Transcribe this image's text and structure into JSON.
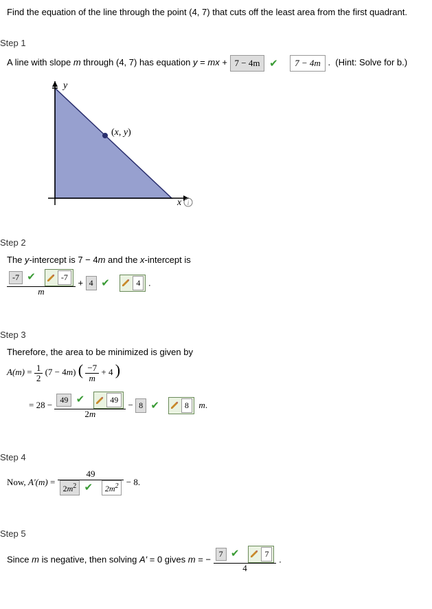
{
  "question": "Find the equation of the line through the point (4, 7) that cuts off the least area from the first quadrant.",
  "step1": {
    "label": "Step 1",
    "pre": "A line with slope ",
    "m": "m",
    "mid": " through (4, 7) has equation ",
    "eq_lhs": "y",
    "eq_mid": " = ",
    "eq_rhs_a": "mx",
    "eq_plus": " + ",
    "answer": "7 − 4m",
    "graded": "7 − 4m",
    "hint": "(Hint: Solve for b.)",
    "dot": "."
  },
  "diagram": {
    "y": "y",
    "x": "x",
    "label": "(x, y)"
  },
  "step2": {
    "label": "Step 2",
    "text_a": "The ",
    "yint": "y",
    "text_b": "-intercept is 7 − 4",
    "m": "m",
    "text_c": " and the ",
    "xint": "x",
    "text_d": "-intercept is",
    "ans1": "-7",
    "ans1_rev": "-7",
    "plus": " + ",
    "ans2": "4",
    "ans2_rev": "4",
    "m_den": "m",
    "period": "."
  },
  "step3": {
    "label": "Step 3",
    "text": "Therefore, the area to be minimized is given by",
    "Am": "A(m)",
    "eq": " = ",
    "half_num": "1",
    "half_den": "2",
    "factor1": "(7 − 4m)",
    "inner_num": "−7",
    "inner_den": "m",
    "inner_plus": " + 4",
    "line2_eq": " = 28 − ",
    "ans_a": "49",
    "ans_a_rev": "49",
    "den_2m": "2m",
    "minus": " − ",
    "ans_b": "8",
    "ans_b_rev": "8",
    "m_suffix": "m."
  },
  "step4": {
    "label": "Step 4",
    "now": "Now, ",
    "Apm": "A'(m)",
    "eq": " = ",
    "num": "49",
    "den_2m2": "2m",
    "sq": "2",
    "graded_2m2": "2m",
    "graded_sq": "2",
    "minus8": " − 8."
  },
  "step5": {
    "label": "Step 5",
    "text_a": "Since ",
    "m": "m",
    "text_b": " is negative, then solving ",
    "Ap": "A'",
    "text_c": " = 0 gives ",
    "m2": "m",
    "text_d": " = − ",
    "num": "7",
    "num_rev": "7",
    "den": "4",
    "period": "."
  }
}
